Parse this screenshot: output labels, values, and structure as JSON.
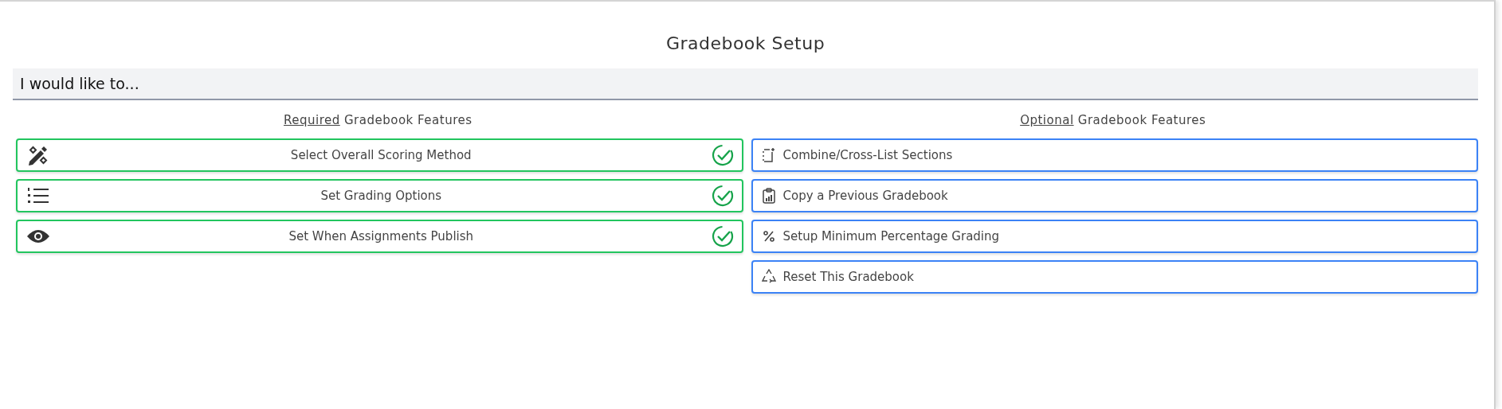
{
  "title": "Gradebook Setup",
  "prompt": "I would like to...",
  "sections": [
    {
      "heading": {
        "marked": "Required",
        "rest": "Gradebook Features"
      },
      "kind": "required",
      "items": [
        {
          "label": "Select Overall Scoring Method",
          "completed": true
        },
        {
          "label": "Set Grading Options",
          "completed": true
        },
        {
          "label": "Set When Assignments Publish",
          "completed": true
        }
      ]
    },
    {
      "heading": {
        "marked": "Optional",
        "rest": "Gradebook Features"
      },
      "kind": "optional",
      "items": [
        {
          "label": "Combine/Cross-List Sections"
        },
        {
          "label": "Copy a Previous Gradebook"
        },
        {
          "label": "Setup Minimum Percentage Grading"
        },
        {
          "label": "Reset This Gradebook"
        }
      ]
    }
  ]
}
